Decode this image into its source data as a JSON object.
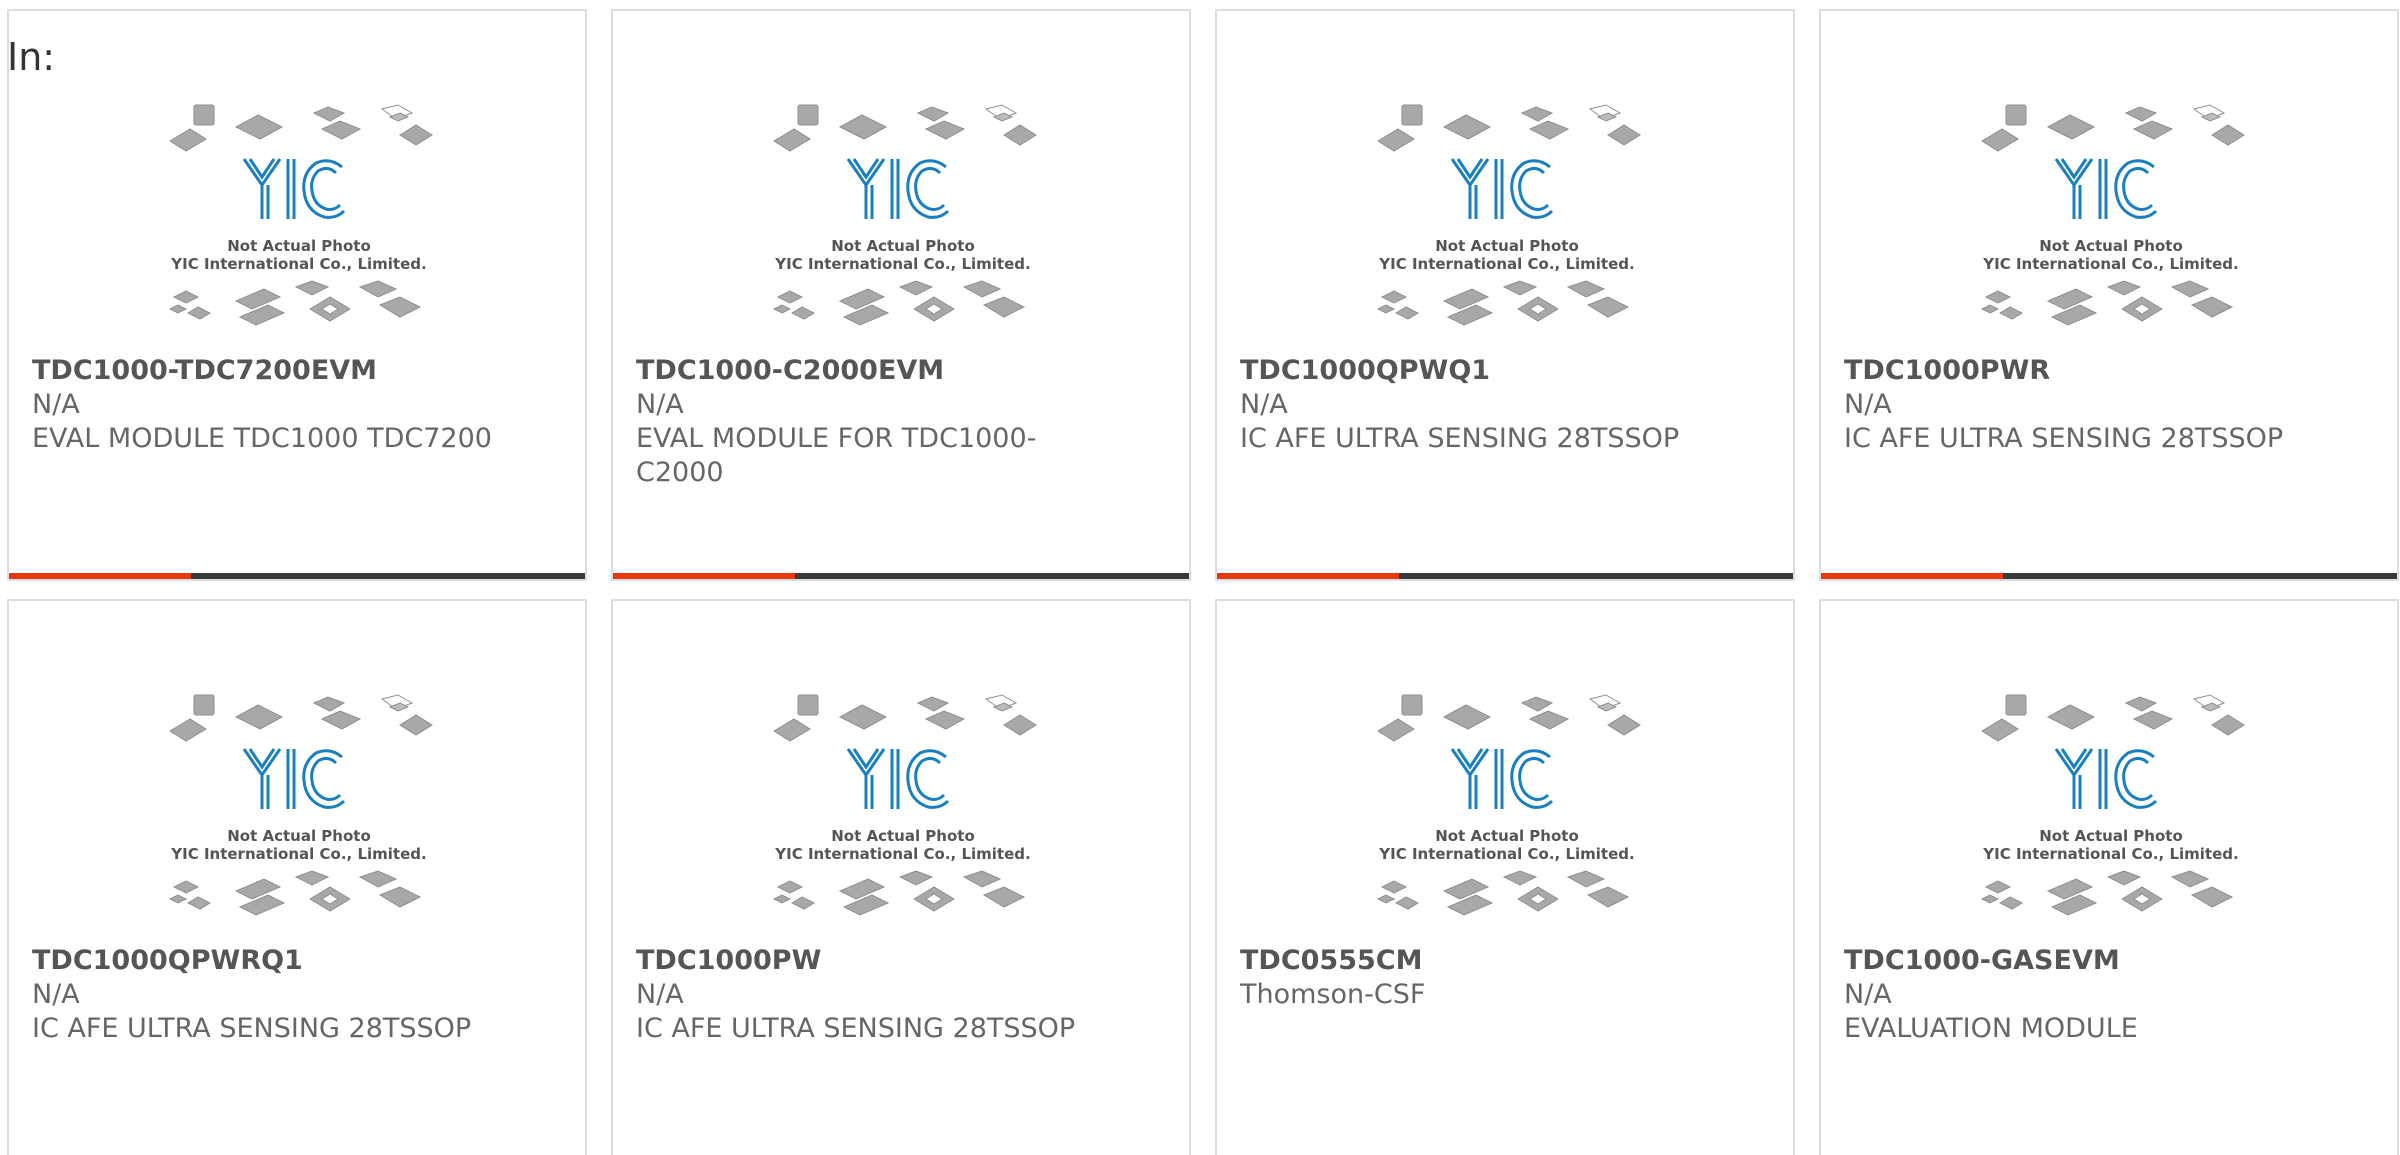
{
  "header": {
    "in_label": "In:"
  },
  "colors": {
    "accent": "#e8380d",
    "bar_dark": "#3a3a3a",
    "logo_blue": "#1a7fc1",
    "chip_gray": "#a8a8a8"
  },
  "placeholder_image": {
    "line1": "Not Actual Photo",
    "line2": "YIC International Co., Limited.",
    "logo_text": "YIC"
  },
  "products": [
    {
      "part_number": "TDC1000-TDC7200EVM",
      "manufacturer": "N/A",
      "description": "EVAL MODULE TDC1000 TDC7200"
    },
    {
      "part_number": "TDC1000-C2000EVM",
      "manufacturer": "N/A",
      "description": "EVAL MODULE FOR TDC1000-C2000"
    },
    {
      "part_number": "TDC1000QPWQ1",
      "manufacturer": "N/A",
      "description": "IC AFE ULTRA SENSING 28TSSOP"
    },
    {
      "part_number": "TDC1000PWR",
      "manufacturer": "N/A",
      "description": "IC AFE ULTRA SENSING 28TSSOP"
    },
    {
      "part_number": "TDC1000QPWRQ1",
      "manufacturer": "N/A",
      "description": "IC AFE ULTRA SENSING 28TSSOP"
    },
    {
      "part_number": "TDC1000PW",
      "manufacturer": "N/A",
      "description": "IC AFE ULTRA SENSING 28TSSOP"
    },
    {
      "part_number": "TDC0555CM",
      "manufacturer": "Thomson-CSF",
      "description": ""
    },
    {
      "part_number": "TDC1000-GASEVM",
      "manufacturer": "N/A",
      "description": "EVALUATION MODULE"
    }
  ]
}
